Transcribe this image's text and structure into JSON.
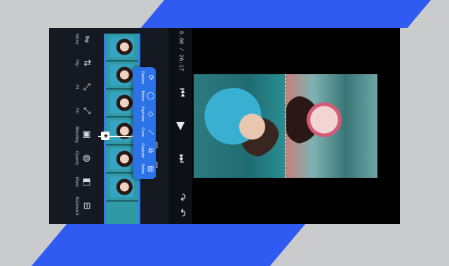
{
  "playback": {
    "time": "0.00 / 26.17"
  },
  "icons": {
    "prev": "skip-back-icon",
    "play": "play-icon",
    "next": "skip-forward-icon",
    "redo": "redo-icon",
    "undo": "undo-icon"
  },
  "popup": {
    "items": [
      {
        "label": "Replace"
      },
      {
        "label": "Motion"
      },
      {
        "label": "Keyframe"
      },
      {
        "label": "Curve"
      },
      {
        "label": "Duplicate"
      },
      {
        "label": "Delete"
      }
    ]
  },
  "toolbar": {
    "items": [
      {
        "label": "Mirror"
      },
      {
        "label": "Flip"
      },
      {
        "label": "Fit"
      },
      {
        "label": "Fill"
      },
      {
        "label": "Blending"
      },
      {
        "label": "Opacity"
      },
      {
        "label": "Mask"
      },
      {
        "label": "Backward"
      }
    ]
  },
  "colors": {
    "accent": "#2e7df7",
    "background": "#c9cbcd",
    "banner": "#2f5bf0"
  }
}
